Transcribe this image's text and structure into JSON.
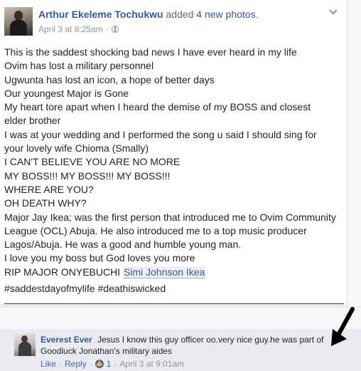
{
  "post": {
    "author": "Arthur Ekeleme Tochukwu",
    "action_prefix": "added",
    "action_highlight": "4 new photos",
    "action_suffix": ".",
    "timestamp": "April 3 at 8:25am",
    "separator": "·",
    "privacy_icon": "globe-icon",
    "menu_icon": "chevron-down-icon",
    "lines": [
      "This is the saddest shocking bad news I have ever heard in my life",
      "Ovim has lost a military personnel",
      "Ugwunta has lost an icon, a hope of better days",
      "Our youngest Major is Gone",
      "My heart tore apart when I heard the demise of my BOSS and closest",
      "elder brother",
      "I was at your wedding and I performed the song u said I should sing for",
      "your lovely wife Chioma (Smally)",
      "I CAN'T BELIEVE YOU ARE NO MORE",
      "MY BOSS!!! MY BOSS!!! MY BOSS!!!",
      "WHERE ARE YOU?",
      "OH DEATH WHY?",
      "Major Jay Ikea; was the first person that introduced me to Ovim Community",
      "League (OCL) Abuja. He also introduced me to a top music producer",
      "Lagos/Abuja. He was a good and humble young man.",
      "I love you my boss but God loves you more"
    ],
    "last_line_prefix": "RIP MAJOR ONYEBUCHI",
    "mention": "Simi Johnson Ikea",
    "hashtags": "#saddestdayofmylife #deathiswicked"
  },
  "comment": {
    "author": "Everest Ever",
    "text": "Jesus I know this guy officer oo.very nice guy.he was part of Goodluck Jonathan's military aides",
    "like_label": "Like",
    "reply_label": "Reply",
    "dot": "·",
    "reaction_icon": "thumbs-up-icon",
    "reaction_count": "1",
    "timestamp": "April 3 at 9:01am"
  },
  "annotation": {
    "icon": "arrow-pointer-icon"
  }
}
